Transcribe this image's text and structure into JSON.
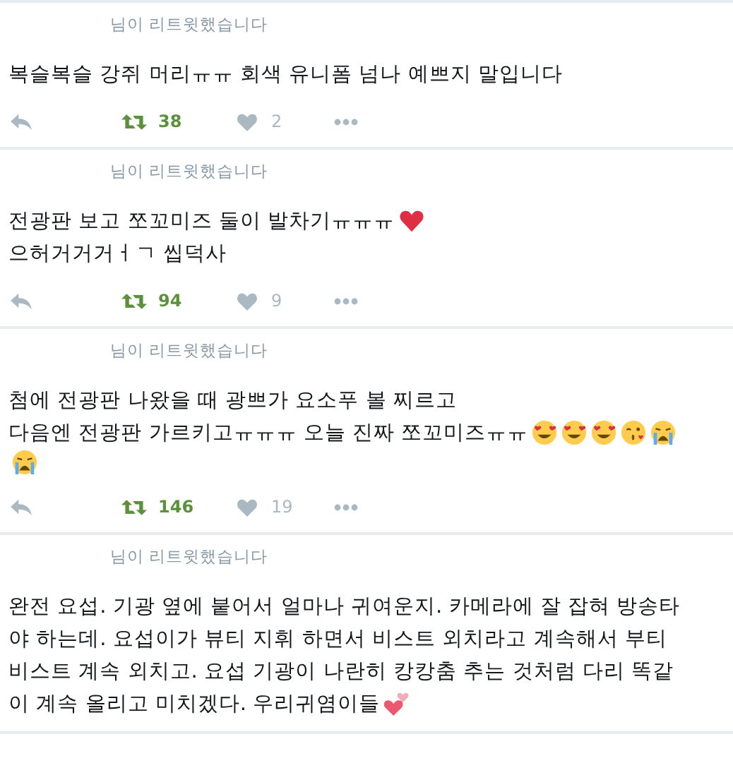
{
  "tweets": [
    {
      "retweet_label": "님이 리트윗했습니다",
      "lines": [
        "복슬복슬 강쥐 머리ㅠㅠ 회색 유니폼 넘나 예쁘지 말입니다"
      ],
      "retweets": "38",
      "retweeted": true,
      "likes": "2",
      "liked": false
    },
    {
      "retweet_label": "님이 리트윗했습니다",
      "lines": [
        "전광판 보고 쪼꼬미즈 둘이 발차기ㅠㅠㅠ",
        "으허거거거ㅓㄱ 씹덕사"
      ],
      "retweets": "94",
      "retweeted": true,
      "likes": "9",
      "liked": false
    },
    {
      "retweet_label": "님이 리트윗했습니다",
      "lines": [
        "첨에 전광판 나왔을 때 광쁘가 요소푸 볼 찌르고",
        "다음엔 전광판 가르키고ㅠㅠㅠ 오늘 진짜 쪼꼬미즈ㅠㅠ"
      ],
      "retweets": "146",
      "retweeted": true,
      "likes": "19",
      "liked": false
    },
    {
      "retweet_label": "님이 리트윗했습니다",
      "lines": [
        "완전 요섭. 기광 옆에 붙어서 얼마나 귀여운지. 카메라에 잘 잡혀 방송타",
        "야 하는데. 요섭이가 뷰티 지휘 하면서 비스트 외치라고 계속해서 부티",
        "비스트 계속 외치고. 요섭 기광이 나란히 캉캉춤 추는 것처럼 다리 똑같",
        "이 계속 올리고 미치겠다. 우리귀염이들"
      ]
    }
  ]
}
